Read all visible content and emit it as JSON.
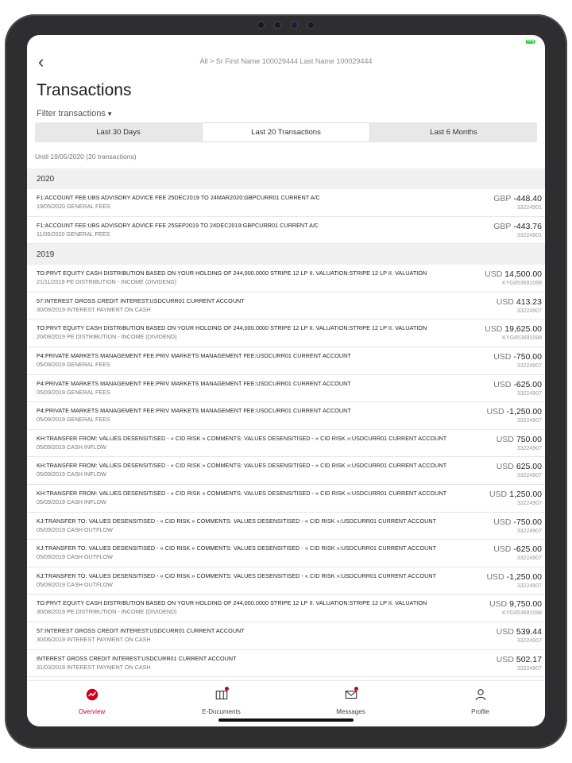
{
  "header": {
    "back_glyph": "‹",
    "breadcrumb": "All > Sr First Name 100029444 Last Name 100029444",
    "title": "Transactions",
    "filter_label": "Filter transactions",
    "filter_caret": "▾"
  },
  "segments": [
    {
      "label": "Last 30 Days",
      "active": false
    },
    {
      "label": "Last 20 Transactions",
      "active": true
    },
    {
      "label": "Last 6 Months",
      "active": false
    }
  ],
  "until_text": "Until 19/05/2020 (20 transactions)",
  "groups": [
    {
      "year": "2020",
      "rows": [
        {
          "desc": "F1:ACCOUNT FEE:UBS ADVISORY ADVICE FEE 25DEC2019 TO 24MAR2020:GBPCURR01 CURRENT A/C",
          "sub": "19/05/2020 GENERAL FEES",
          "currency": "GBP",
          "amount": "-448.40",
          "account": "33224901"
        },
        {
          "desc": "F1:ACCOUNT FEE:UBS ADVISORY ADVICE FEE 25SEP2019 TO 24DEC2019:GBPCURR01 CURRENT A/C",
          "sub": "11/05/2020 GENERAL FEES",
          "currency": "GBP",
          "amount": "-443.76",
          "account": "33224901"
        }
      ]
    },
    {
      "year": "2019",
      "rows": [
        {
          "desc": "TO:PRVT EQUITY CASH DISTRIBUTION BASED ON YOUR HOLDING OF 244,000.0000 STRIPE 12 LP II. VALUATION:STRIPE 12 LP II. VALUATION",
          "sub": "21/11/2019 PE DISTRIBUTION - INCOME (DIVIDEND)",
          "currency": "USD",
          "amount": "14,500.00",
          "account": "KYG853691098"
        },
        {
          "desc": "57:INTEREST GROSS CREDIT INTEREST:USDCURR01 CURRENT ACCOUNT",
          "sub": "30/09/2019 INTEREST PAYMENT ON CASH",
          "currency": "USD",
          "amount": "413.23",
          "account": "33224907"
        },
        {
          "desc": "TO:PRVT EQUITY CASH DISTRIBUTION BASED ON YOUR HOLDING OF 244,000.0000 STRIPE 12 LP II. VALUATION:STRIPE 12 LP II. VALUATION",
          "sub": "20/09/2019 PE DISTRIBUTION - INCOME (DIVIDEND)",
          "currency": "USD",
          "amount": "19,625.00",
          "account": "KYG853691098"
        },
        {
          "desc": "P4:PRIVATE MARKETS MANAGEMENT FEE:PRIV MARKETS MANAGEMENT FEE:USDCURR01 CURRENT ACCOUNT",
          "sub": "05/09/2019 GENERAL FEES",
          "currency": "USD",
          "amount": "-750.00",
          "account": "33224907"
        },
        {
          "desc": "P4:PRIVATE MARKETS MANAGEMENT FEE:PRIV MARKETS MANAGEMENT FEE:USDCURR01 CURRENT ACCOUNT",
          "sub": "05/09/2019 GENERAL FEES",
          "currency": "USD",
          "amount": "-625.00",
          "account": "33224907"
        },
        {
          "desc": "P4:PRIVATE MARKETS MANAGEMENT FEE:PRIV MARKETS MANAGEMENT FEE:USDCURR01 CURRENT ACCOUNT",
          "sub": "05/09/2019 GENERAL FEES",
          "currency": "USD",
          "amount": "-1,250.00",
          "account": "33224907"
        },
        {
          "desc": "KH:TRANSFER FROM: VALUES DESENSITISED - « CID RISK » COMMENTS: VALUES DESENSITISED - « CID RISK »:USDCURR01 CURRENT ACCOUNT",
          "sub": "05/09/2019 CASH INFLOW",
          "currency": "USD",
          "amount": "750.00",
          "account": "33224907"
        },
        {
          "desc": "KH:TRANSFER FROM: VALUES DESENSITISED - « CID RISK » COMMENTS: VALUES DESENSITISED - « CID RISK »:USDCURR01 CURRENT ACCOUNT",
          "sub": "05/09/2019 CASH INFLOW",
          "currency": "USD",
          "amount": "625.00",
          "account": "33224907"
        },
        {
          "desc": "KH:TRANSFER FROM: VALUES DESENSITISED - « CID RISK » COMMENTS: VALUES DESENSITISED - « CID RISK »:USDCURR01 CURRENT ACCOUNT",
          "sub": "05/09/2019 CASH INFLOW",
          "currency": "USD",
          "amount": "1,250.00",
          "account": "33224907"
        },
        {
          "desc": "KJ:TRANSFER TO: VALUES DESENSITISED - « CID RISK » COMMENTS: VALUES DESENSITISED - « CID RISK »:USDCURR01 CURRENT ACCOUNT",
          "sub": "05/09/2019 CASH OUTFLOW",
          "currency": "USD",
          "amount": "-750.00",
          "account": "33224907"
        },
        {
          "desc": "KJ:TRANSFER TO: VALUES DESENSITISED - « CID RISK » COMMENTS: VALUES DESENSITISED - « CID RISK »:USDCURR01 CURRENT ACCOUNT",
          "sub": "05/09/2019 CASH OUTFLOW",
          "currency": "USD",
          "amount": "-625.00",
          "account": "33224907"
        },
        {
          "desc": "KJ:TRANSFER TO: VALUES DESENSITISED - « CID RISK » COMMENTS: VALUES DESENSITISED - « CID RISK »:USDCURR01 CURRENT ACCOUNT",
          "sub": "05/09/2019 CASH OUTFLOW",
          "currency": "USD",
          "amount": "-1,250.00",
          "account": "33224907"
        },
        {
          "desc": "TO:PRVT EQUITY CASH DISTRIBUTION BASED ON YOUR HOLDING OF 244,000.0000 STRIPE 12 LP II. VALUATION:STRIPE 12 LP II. VALUATION",
          "sub": "30/08/2019 PE DISTRIBUTION - INCOME (DIVIDEND)",
          "currency": "USD",
          "amount": "9,750.00",
          "account": "KYG853691098"
        },
        {
          "desc": "57:INTEREST GROSS CREDIT INTEREST:USDCURR01 CURRENT ACCOUNT",
          "sub": "30/06/2019 INTEREST PAYMENT ON CASH",
          "currency": "USD",
          "amount": "539.44",
          "account": "33224907"
        },
        {
          "desc": "INTEREST GROSS CREDIT INTEREST:USDCURR01 CURRENT ACCOUNT",
          "sub": "31/03/2019 INTEREST PAYMENT ON CASH",
          "currency": "USD",
          "amount": "502.17",
          "account": "33224907"
        }
      ]
    }
  ],
  "tabbar": [
    {
      "label": "Overview",
      "icon": "overview-icon",
      "active": true,
      "badge": false
    },
    {
      "label": "E-Documents",
      "icon": "documents-icon",
      "active": false,
      "badge": true
    },
    {
      "label": "Messages",
      "icon": "envelope-icon",
      "active": false,
      "badge": true
    },
    {
      "label": "Profile",
      "icon": "person-icon",
      "active": false,
      "badge": false
    }
  ],
  "colors": {
    "accent": "#d0021b",
    "battery": "#2ecc40"
  }
}
